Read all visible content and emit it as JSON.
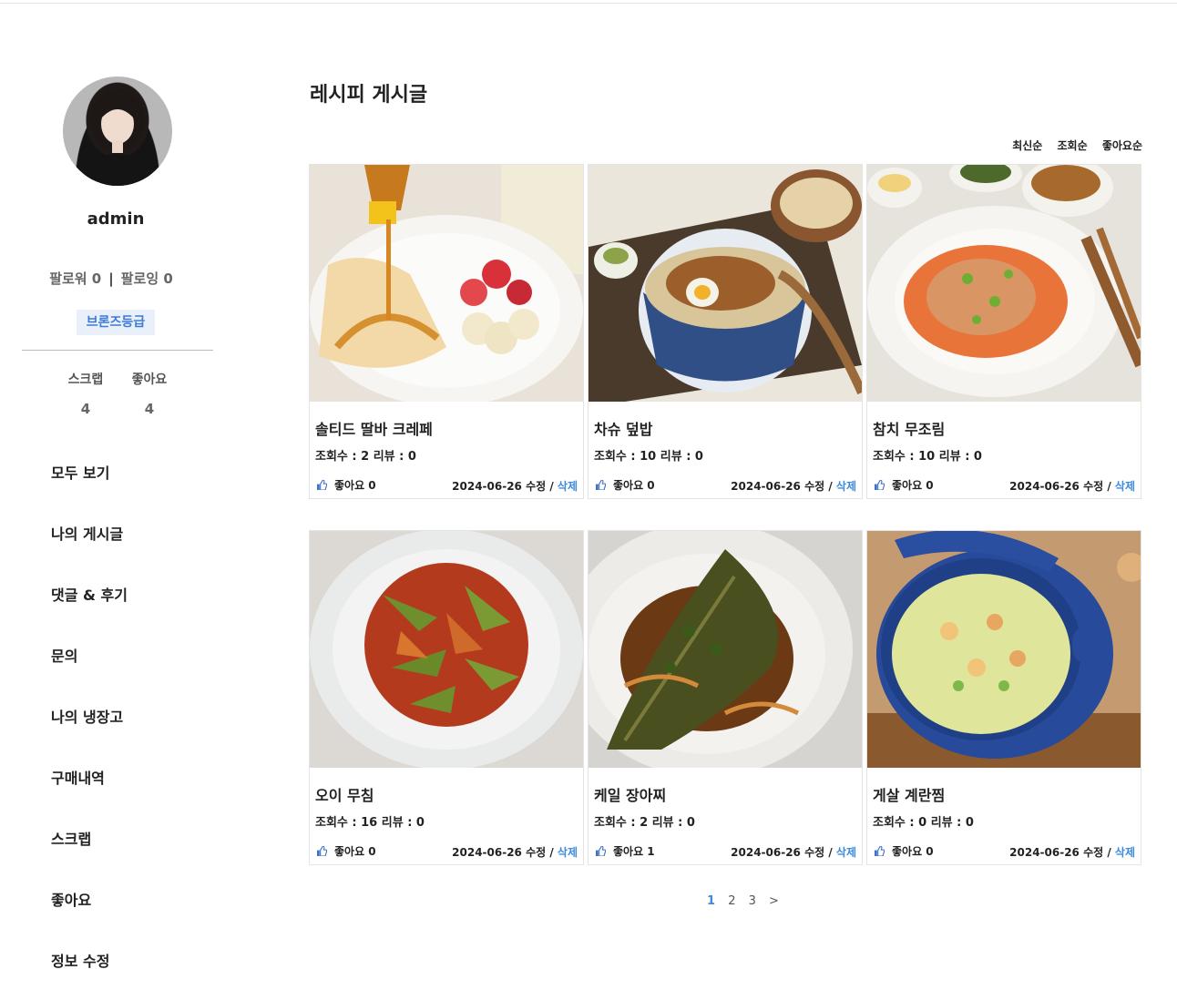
{
  "profile": {
    "username": "admin",
    "followers_label": "팔로워 0",
    "following_label": "팔로잉 0",
    "separator": "|",
    "grade": "브론즈등급",
    "scrap_label": "스크랩",
    "scrap_count": "4",
    "like_label": "좋아요",
    "like_count": "4"
  },
  "menu": [
    "모두 보기",
    "나의 게시글",
    "댓글 & 후기",
    "문의",
    "나의 냉장고",
    "구매내역",
    "스크랩",
    "좋아요",
    "정보 수정"
  ],
  "main": {
    "title": "레시피 게시글",
    "sort_options": [
      "최신순",
      "조회순",
      "좋아요순"
    ]
  },
  "cards": [
    {
      "title": "솔티드 딸바 크레페",
      "meta": "조회수 : 2 리뷰 : 0",
      "like": "좋아요 0",
      "date": "2024-06-26 수정 / ",
      "delete": "삭제",
      "image": "crepe-food-photo"
    },
    {
      "title": "차슈 덮밥",
      "meta": "조회수 : 10 리뷰 : 0",
      "like": "좋아요 0",
      "date": "2024-06-26 수정 / ",
      "delete": "삭제",
      "image": "chashu-bowl-food-photo"
    },
    {
      "title": "참치 무조림",
      "meta": "조회수 : 10 리뷰 : 0",
      "like": "좋아요 0",
      "date": "2024-06-26 수정 / ",
      "delete": "삭제",
      "image": "tuna-radish-food-photo"
    },
    {
      "title": "오이 무침",
      "meta": "조회수 : 16 리뷰 : 0",
      "like": "좋아요 0",
      "date": "2024-06-26 수정 / ",
      "delete": "삭제",
      "image": "cucumber-salad-food-photo"
    },
    {
      "title": "케일 장아찌",
      "meta": "조회수 : 2 리뷰 : 0",
      "like": "좋아요 1",
      "date": "2024-06-26 수정 / ",
      "delete": "삭제",
      "image": "kale-pickle-food-photo"
    },
    {
      "title": "게살 계란찜",
      "meta": "조회수 : 0 리뷰 : 0",
      "like": "좋아요 0",
      "date": "2024-06-26 수정 / ",
      "delete": "삭제",
      "image": "crab-egg-food-photo"
    }
  ],
  "pagination": {
    "pages": [
      "1",
      "2",
      "3"
    ],
    "next": ">",
    "current": "1"
  },
  "colors": {
    "accent": "#3d8be0",
    "grade_bg": "#eaf0fa"
  }
}
